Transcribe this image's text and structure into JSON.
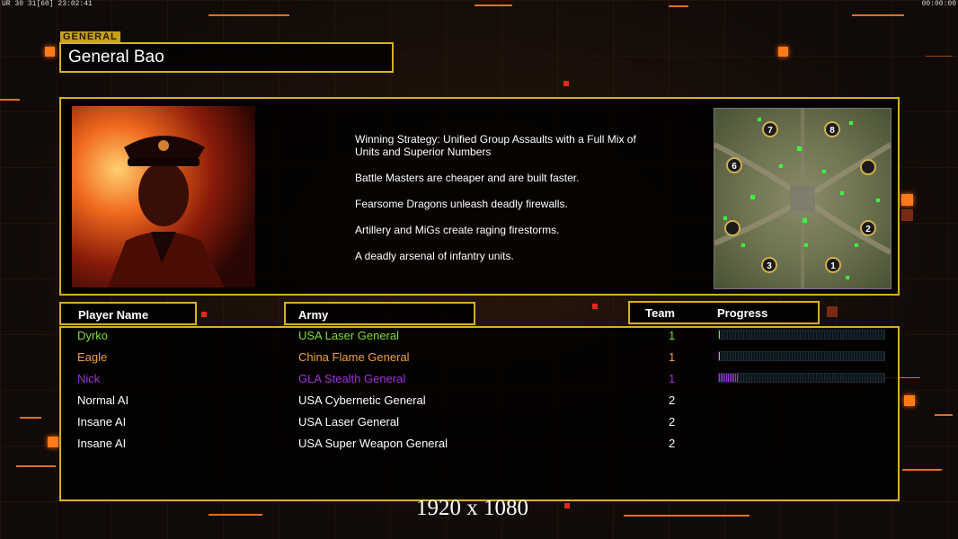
{
  "hud": {
    "left_text": "UR 30 31[60] 23:02:41",
    "right_text": "00:00:00"
  },
  "header": {
    "tag": "GENERAL",
    "name": "General Bao"
  },
  "strategy": {
    "lines": [
      "Winning Strategy: Unified Group Assaults with a Full Mix of Units and Superior Numbers",
      "Battle Masters are cheaper and are built faster.",
      "Fearsome Dragons unleash deadly firewalls.",
      "Artillery and MiGs create raging firestorms.",
      "A deadly arsenal of infantry units."
    ]
  },
  "minimap": {
    "start_positions": [
      "7",
      "8",
      "6",
      "2",
      "3",
      "1"
    ]
  },
  "table": {
    "headers": {
      "player": "Player Name",
      "army": "Army",
      "team": "Team",
      "progress": "Progress"
    },
    "rows": [
      {
        "name": "Dyrko",
        "army": "USA Laser General",
        "team": "1",
        "color": "#7fdc2a",
        "progress": 0.01
      },
      {
        "name": "Eagle",
        "army": "China Flame General",
        "team": "1",
        "color": "#f0a040",
        "progress": 0.01
      },
      {
        "name": "Nick",
        "army": "GLA Stealth General",
        "team": "1",
        "color": "#a030e0",
        "progress": 0.12
      },
      {
        "name": "Normal AI",
        "army": "USA Cybernetic General",
        "team": "2",
        "color": "#ffffff",
        "progress": null
      },
      {
        "name": "Insane AI",
        "army": "USA Laser General",
        "team": "2",
        "color": "#ffffff",
        "progress": null
      },
      {
        "name": "Insane AI",
        "army": "USA Super Weapon General",
        "team": "2",
        "color": "#ffffff",
        "progress": null
      }
    ]
  },
  "footer": {
    "resolution": "1920 x 1080"
  },
  "colors": {
    "border_gold": "#d7b11e",
    "accent_orange": "#ff7a18"
  }
}
